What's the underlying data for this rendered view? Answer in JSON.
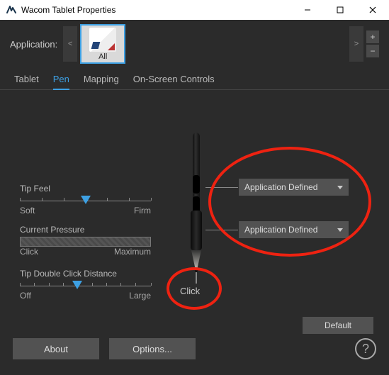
{
  "window": {
    "title": "Wacom Tablet Properties"
  },
  "appRow": {
    "label": "Application:",
    "selected": "All"
  },
  "tabs": [
    "Tablet",
    "Pen",
    "Mapping",
    "On-Screen Controls"
  ],
  "activeTab": "Pen",
  "tipFeel": {
    "label": "Tip Feel",
    "left": "Soft",
    "right": "Firm",
    "pos": 0.5
  },
  "pressure": {
    "label": "Current Pressure",
    "left": "Click",
    "right": "Maximum"
  },
  "dblClick": {
    "label": "Tip Double Click Distance",
    "left": "Off",
    "right": "Large",
    "pos": 0.44
  },
  "penTipLabel": "Click",
  "penButtons": {
    "top": "Application Defined",
    "bottom": "Application Defined"
  },
  "defaultBtn": "Default",
  "footer": {
    "about": "About",
    "options": "Options..."
  }
}
